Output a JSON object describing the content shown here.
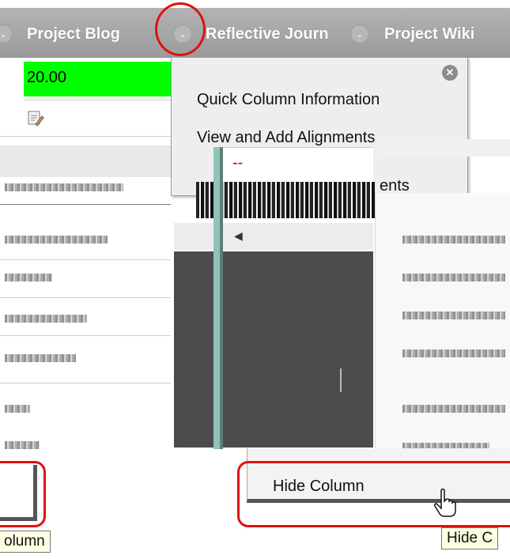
{
  "header": {
    "columns": [
      {
        "title": "Project Blog"
      },
      {
        "title": "Reflective Journ"
      },
      {
        "title": "Project Wiki"
      }
    ]
  },
  "grade_row": {
    "value": "20.00"
  },
  "menu": {
    "items": [
      {
        "label": "Quick Column Information"
      },
      {
        "label": "View and Add Alignments"
      },
      {
        "label": "--"
      },
      {
        "label": "ents"
      }
    ]
  },
  "hide_menu": {
    "label": "Hide Column"
  },
  "tooltips": {
    "left": "olumn",
    "right": "Hide C"
  },
  "icons": {
    "chevron": "chevron-down-icon",
    "close": "close-icon",
    "edit": "edit-grade-icon",
    "cursor_text": "text-cursor-icon",
    "cursor_hand": "hand-pointer-icon"
  },
  "colors": {
    "highlight": "#e01010",
    "grade_cell": "#00ff00",
    "header": "#a8a8a8"
  }
}
